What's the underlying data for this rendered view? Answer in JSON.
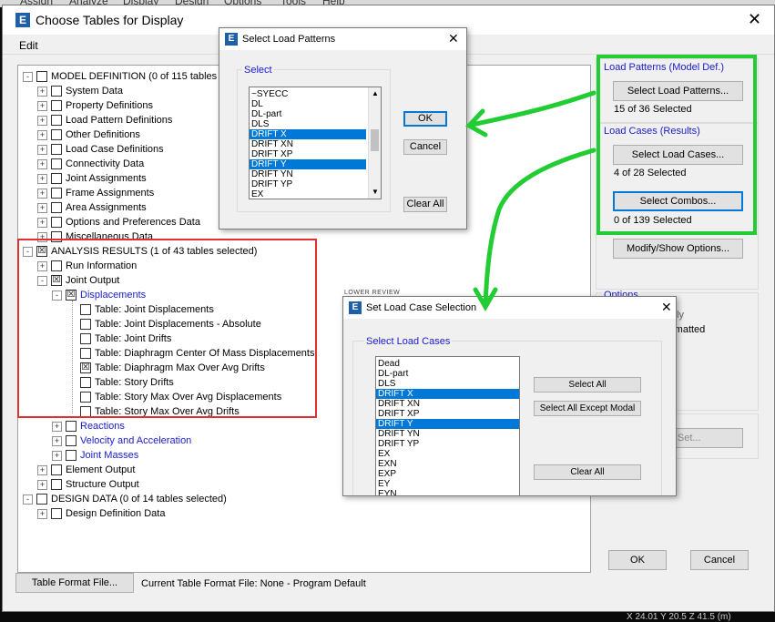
{
  "bg_menu": [
    "Assign",
    "Analyze",
    "Display",
    "Design",
    "Options",
    "Tools",
    "Help"
  ],
  "app_icon": "E",
  "window": {
    "title": "Choose Tables for Display",
    "close": "✕"
  },
  "menu": {
    "edit": "Edit"
  },
  "tree": [
    {
      "exp": "-",
      "chk": "",
      "label": "MODEL DEFINITION  (0 of 115 tables selected)",
      "blue": false
    },
    {
      "exp": "+",
      "chk": "",
      "label": "System Data",
      "blue": false
    },
    {
      "exp": "+",
      "chk": "",
      "label": "Property Definitions",
      "blue": false
    },
    {
      "exp": "+",
      "chk": "",
      "label": "Load Pattern Definitions",
      "blue": false
    },
    {
      "exp": "+",
      "chk": "",
      "label": "Other Definitions",
      "blue": false
    },
    {
      "exp": "+",
      "chk": "",
      "label": "Load Case Definitions",
      "blue": false
    },
    {
      "exp": "+",
      "chk": "",
      "label": "Connectivity Data",
      "blue": false
    },
    {
      "exp": "+",
      "chk": "",
      "label": "Joint Assignments",
      "blue": false
    },
    {
      "exp": "+",
      "chk": "",
      "label": "Frame Assignments",
      "blue": false
    },
    {
      "exp": "+",
      "chk": "",
      "label": "Area Assignments",
      "blue": false
    },
    {
      "exp": "+",
      "chk": "",
      "label": "Options and Preferences Data",
      "blue": false
    },
    {
      "exp": "+",
      "chk": "",
      "label": "Miscellaneous Data",
      "blue": false
    },
    {
      "exp": "-",
      "chk": "☒",
      "label": "ANALYSIS RESULTS  (1 of 43 tables selected)",
      "blue": false
    },
    {
      "exp": "+",
      "chk": "",
      "label": "Run Information",
      "blue": false
    },
    {
      "exp": "-",
      "chk": "☒",
      "label": "Joint Output",
      "blue": false
    },
    {
      "exp": "-",
      "chk": "☒",
      "label": "Displacements",
      "blue": true
    },
    {
      "exp": "",
      "chk": "",
      "label": "Table:  Joint Displacements",
      "blue": false
    },
    {
      "exp": "",
      "chk": "",
      "label": "Table:  Joint Displacements - Absolute",
      "blue": false
    },
    {
      "exp": "",
      "chk": "",
      "label": "Table:  Joint Drifts",
      "blue": false
    },
    {
      "exp": "",
      "chk": "",
      "label": "Table:  Diaphragm Center Of Mass Displacements",
      "blue": false
    },
    {
      "exp": "",
      "chk": "☒",
      "label": "Table:  Diaphragm Max Over Avg Drifts",
      "blue": false
    },
    {
      "exp": "",
      "chk": "",
      "label": "Table:  Story Drifts",
      "blue": false
    },
    {
      "exp": "",
      "chk": "",
      "label": "Table:  Story Max Over Avg Displacements",
      "blue": false
    },
    {
      "exp": "",
      "chk": "",
      "label": "Table:  Story Max Over Avg Drifts",
      "blue": false
    },
    {
      "exp": "+",
      "chk": "",
      "label": "Reactions",
      "blue": true
    },
    {
      "exp": "+",
      "chk": "",
      "label": "Velocity and Acceleration",
      "blue": true
    },
    {
      "exp": "+",
      "chk": "",
      "label": "Joint Masses",
      "blue": true
    },
    {
      "exp": "+",
      "chk": "",
      "label": "Element Output",
      "blue": false
    },
    {
      "exp": "+",
      "chk": "",
      "label": "Structure Output",
      "blue": false
    },
    {
      "exp": "-",
      "chk": "",
      "label": "DESIGN DATA  (0 of 14 tables selected)",
      "blue": false
    },
    {
      "exp": "+",
      "chk": "",
      "label": "Design Definition Data",
      "blue": false
    }
  ],
  "right": {
    "load_patterns_title": "Load Patterns (Model Def.)",
    "select_load_patterns": "Select Load Patterns...",
    "patterns_status": "15 of 36 Selected",
    "load_cases_title": "Load Cases (Results)",
    "select_load_cases": "Select Load Cases...",
    "cases_status": "4 of 28 Selected",
    "select_combos": "Select Combos...",
    "combos_status": "0 of 139 Selected",
    "modify_show": "Modify/Show Options...",
    "options_title": "Options",
    "opt_text1": "nly",
    "opt_text2": "rmatted",
    "named_set_partial": "med Set..."
  },
  "bottom": {
    "table_format_button": "Table Format File...",
    "current_format": "Current Table Format File:  None - Program Default",
    "ok": "OK",
    "cancel": "Cancel",
    "statusbar_partial": "X 24.01  Y 20.5  Z 41.5 (m)"
  },
  "load_patterns_popup": {
    "title": "Select Load Patterns",
    "close": "✕",
    "group": "Select",
    "items": [
      {
        "label": "~SYECC",
        "sel": false
      },
      {
        "label": "DL",
        "sel": false
      },
      {
        "label": "DL-part",
        "sel": false
      },
      {
        "label": "DLS",
        "sel": false
      },
      {
        "label": "DRIFT X",
        "sel": true
      },
      {
        "label": "DRIFT XN",
        "sel": false
      },
      {
        "label": "DRIFT XP",
        "sel": false
      },
      {
        "label": "DRIFT Y",
        "sel": true
      },
      {
        "label": "DRIFT YN",
        "sel": false
      },
      {
        "label": "DRIFT YP",
        "sel": false
      },
      {
        "label": "EX",
        "sel": false
      }
    ],
    "ok": "OK",
    "cancel": "Cancel",
    "clear_all": "Clear All"
  },
  "load_case_popup": {
    "title": "Set Load Case Selection",
    "behind_text": "LOWER REVIEW",
    "group": "Select Load Cases",
    "items": [
      {
        "label": "Dead",
        "sel": false
      },
      {
        "label": "DL-part",
        "sel": false
      },
      {
        "label": "DLS",
        "sel": false
      },
      {
        "label": "DRIFT X",
        "sel": true
      },
      {
        "label": "DRIFT XN",
        "sel": false
      },
      {
        "label": "DRIFT XP",
        "sel": false
      },
      {
        "label": "DRIFT Y",
        "sel": true
      },
      {
        "label": "DRIFT YN",
        "sel": false
      },
      {
        "label": "DRIFT YP",
        "sel": false
      },
      {
        "label": "EX",
        "sel": false
      },
      {
        "label": "EXN",
        "sel": false
      },
      {
        "label": "EXP",
        "sel": false
      },
      {
        "label": "EY",
        "sel": false
      },
      {
        "label": "EYN",
        "sel": false
      }
    ],
    "select_all": "Select All",
    "select_all_except_modal": "Select All Except Modal",
    "clear_all": "Clear All",
    "close": "✕"
  },
  "colors": {
    "highlight_red": "#e03030",
    "highlight_green": "#22cc33",
    "selection": "#0078d7",
    "tree_blue": "#1a1ad0"
  }
}
